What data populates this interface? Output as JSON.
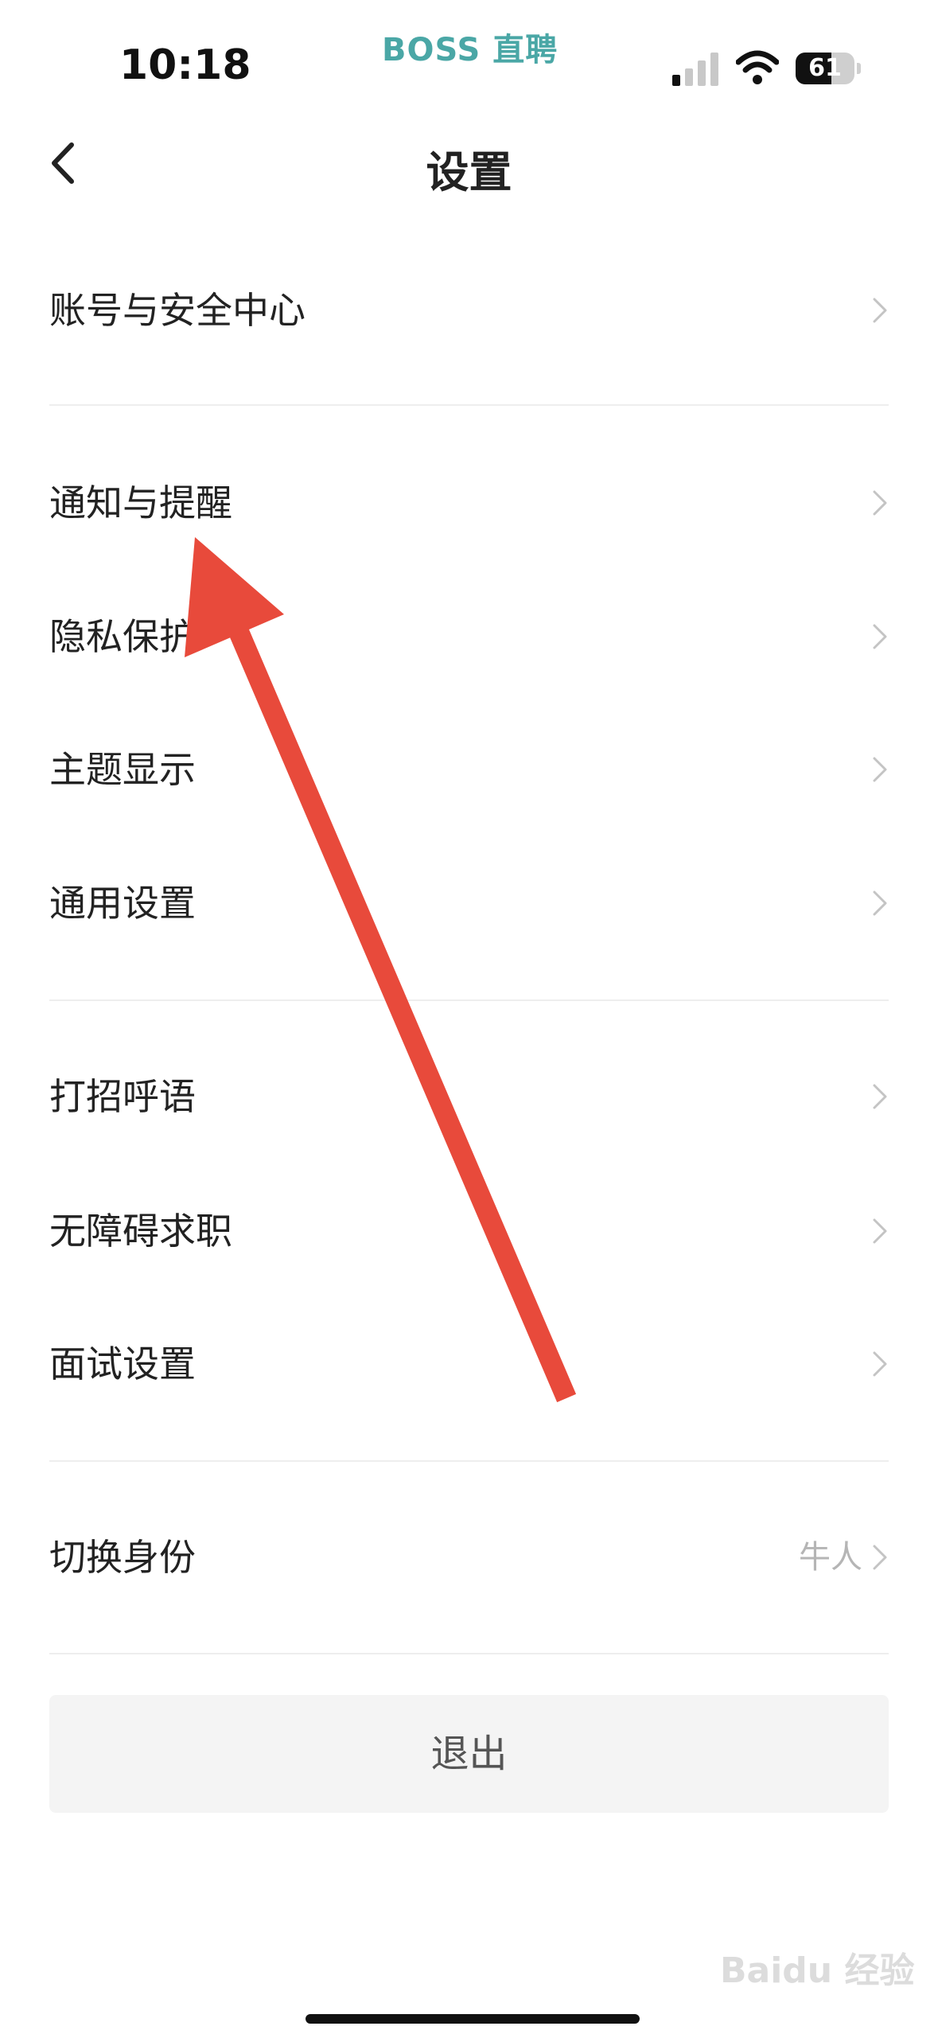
{
  "status_bar": {
    "time": "10:18",
    "brand": "BOSS 直聘",
    "battery": "61",
    "icons": [
      "signal-icon",
      "wifi-icon",
      "battery-icon"
    ]
  },
  "header": {
    "title": "设置",
    "back_icon": "chevron-left-icon"
  },
  "settings": {
    "items": [
      {
        "label": "账号与安全中心"
      },
      {
        "label": "通知与提醒"
      },
      {
        "label": "隐私保护"
      },
      {
        "label": "主题显示"
      },
      {
        "label": "通用设置"
      },
      {
        "label": "打招呼语"
      },
      {
        "label": "无障碍求职"
      },
      {
        "label": "面试设置"
      },
      {
        "label": "切换身份",
        "value": "牛人"
      }
    ]
  },
  "logout": {
    "label": "退出"
  },
  "watermark": "Baidu 经验",
  "colors": {
    "brand": "#4aa7a6",
    "arrow": "#e84a3b",
    "divider": "#eeeeee",
    "logout_bg": "#f4f4f4"
  }
}
